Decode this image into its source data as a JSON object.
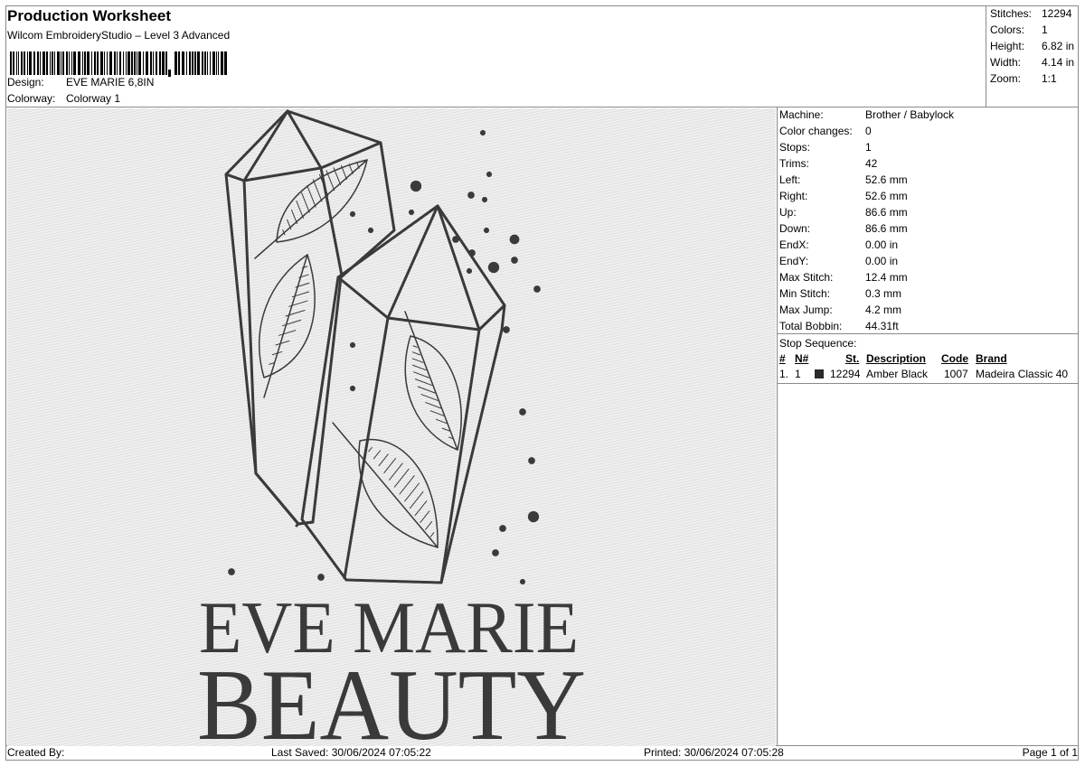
{
  "header": {
    "title": "Production Worksheet",
    "software": "Wilcom EmbroideryStudio – Level 3 Advanced",
    "design_label": "Design:",
    "design_value": "EVE MARIE 6,8IN",
    "colorway_label": "Colorway:",
    "colorway_value": "Colorway 1"
  },
  "summary": [
    {
      "label": "Stitches:",
      "value": "12294"
    },
    {
      "label": "Colors:",
      "value": "1"
    },
    {
      "label": "Height:",
      "value": "6.82 in"
    },
    {
      "label": "Width:",
      "value": "4.14 in"
    },
    {
      "label": "Zoom:",
      "value": "1:1"
    }
  ],
  "details": [
    {
      "label": "Machine:",
      "value": "Brother / Babylock"
    },
    {
      "label": "Color changes:",
      "value": "0"
    },
    {
      "label": "Stops:",
      "value": "1"
    },
    {
      "label": "Trims:",
      "value": "42"
    },
    {
      "label": "Left:",
      "value": "52.6 mm"
    },
    {
      "label": "Right:",
      "value": "52.6 mm"
    },
    {
      "label": "Up:",
      "value": "86.6 mm"
    },
    {
      "label": "Down:",
      "value": "86.6 mm"
    },
    {
      "label": "EndX:",
      "value": "0.00 in"
    },
    {
      "label": "EndY:",
      "value": "0.00 in"
    },
    {
      "label": "Max Stitch:",
      "value": "12.4 mm"
    },
    {
      "label": "Min Stitch:",
      "value": "0.3 mm"
    },
    {
      "label": "Max Jump:",
      "value": "4.2 mm"
    },
    {
      "label": "Total Bobbin:",
      "value": "44.31ft"
    }
  ],
  "stop_sequence": {
    "label": "Stop Sequence:",
    "columns": {
      "num": "#",
      "n": "N#",
      "st": "St.",
      "description": "Description",
      "code": "Code",
      "brand": "Brand"
    },
    "rows": [
      {
        "num": "1.",
        "n": "1",
        "st": "12294",
        "description": "Amber Black",
        "code": "1007",
        "brand": "Madeira Classic 40",
        "color": "#2a2a2a"
      }
    ]
  },
  "preview": {
    "line1": "EVE MARIE",
    "line2": "BEAUTY",
    "thread_color": "#3a3a3a",
    "fabric_color": "#e6e6e6"
  },
  "footer": {
    "created_by": "Created By:",
    "last_saved": "Last Saved: 30/06/2024 07:05:22",
    "printed": "Printed: 30/06/2024 07:05:28",
    "page": "Page 1 of 1"
  }
}
